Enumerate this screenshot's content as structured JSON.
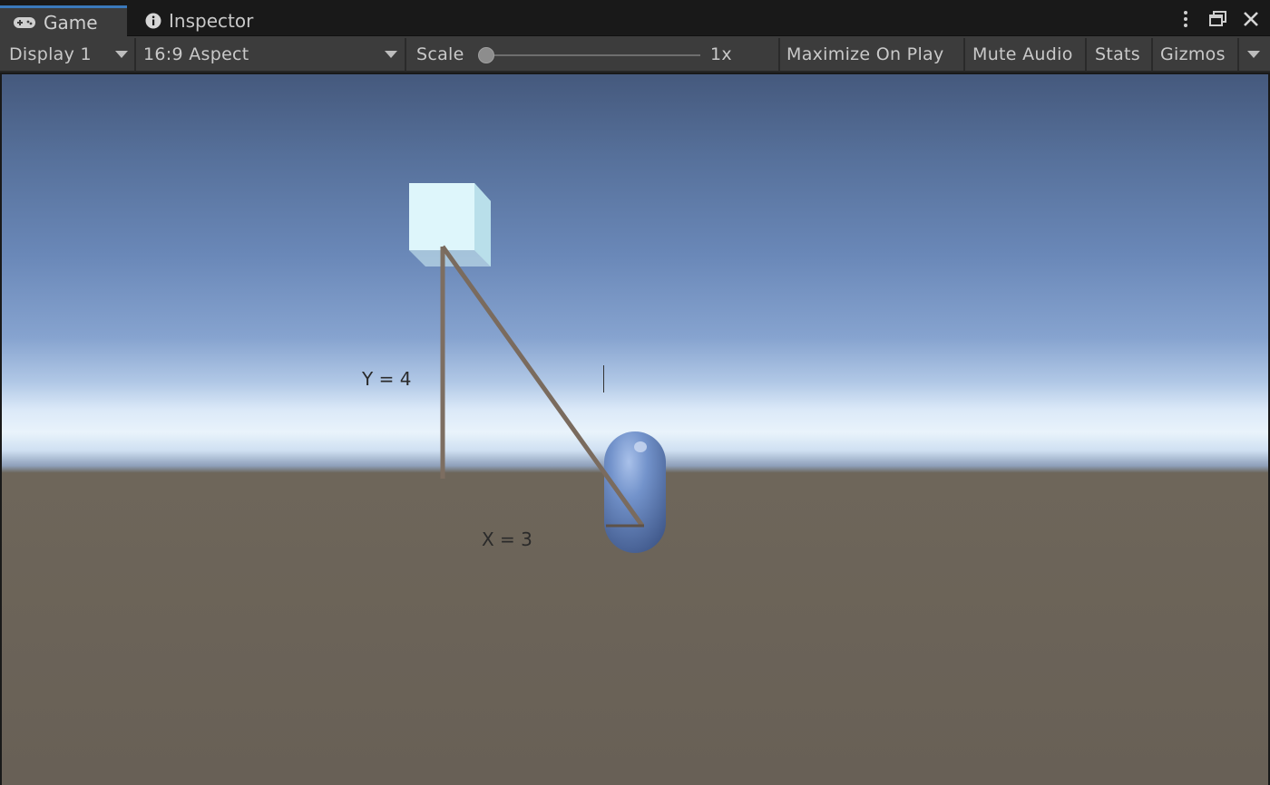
{
  "tabs": [
    {
      "label": "Game",
      "icon": "gamepad-icon",
      "active": true
    },
    {
      "label": "Inspector",
      "icon": "info-icon",
      "active": false
    }
  ],
  "toolbar": {
    "display": "Display 1",
    "aspect": "16:9 Aspect",
    "scale_label": "Scale",
    "scale_value": "1x",
    "scale_fraction": 0.0,
    "maximize_on_play": "Maximize On Play",
    "mute_audio": "Mute Audio",
    "stats": "Stats",
    "gizmos": "Gizmos"
  },
  "scene": {
    "y_label": "Y = 4",
    "x_label": "X = 3"
  },
  "colors": {
    "accent": "#3a79bb",
    "toolbar_bg": "#3c3c3c",
    "ground": "#6b6358",
    "line": "#7a6b5e",
    "capsule": "#6f8fc6",
    "cube": "#def6fb"
  }
}
